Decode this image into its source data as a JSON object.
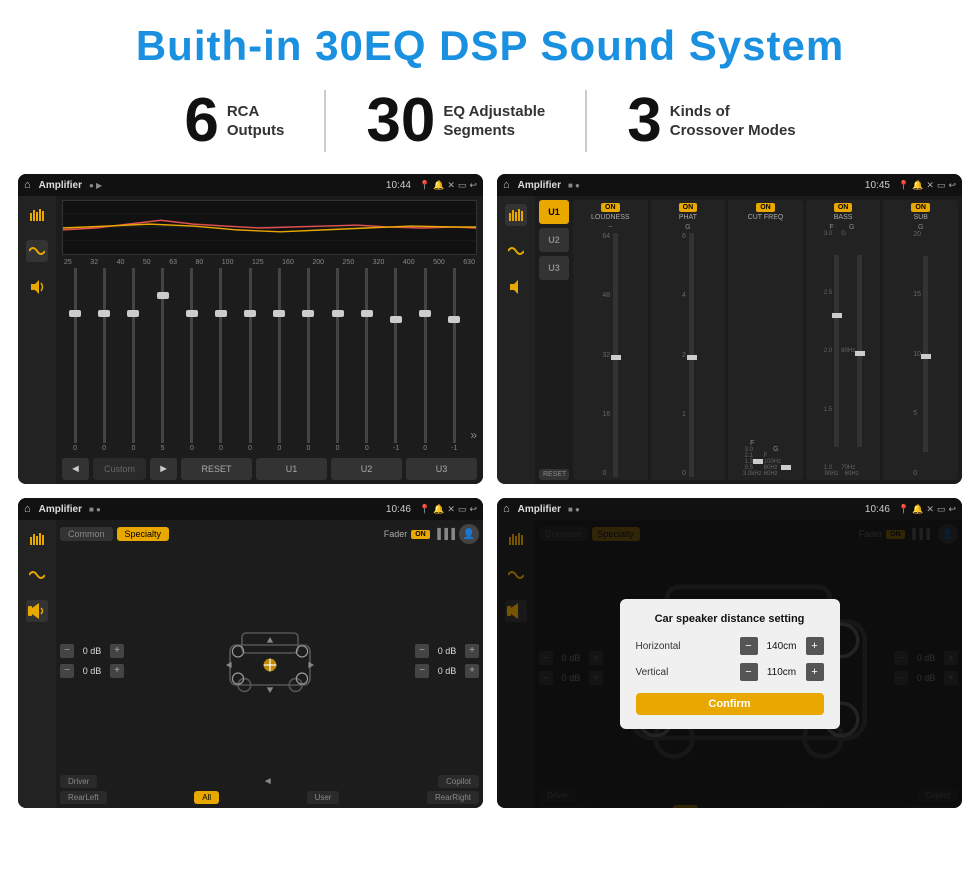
{
  "page": {
    "title": "Buith-in 30EQ DSP Sound System",
    "stats": [
      {
        "number": "6",
        "label": "RCA\nOutputs"
      },
      {
        "number": "30",
        "label": "EQ Adjustable\nSegments"
      },
      {
        "number": "3",
        "label": "Kinds of\nCrossover Modes"
      }
    ],
    "screens": [
      {
        "id": "eq-screen",
        "app_title": "Amplifier",
        "time": "10:44",
        "type": "eq",
        "freq_labels": [
          "25",
          "32",
          "40",
          "50",
          "63",
          "80",
          "100",
          "125",
          "160",
          "200",
          "250",
          "320",
          "400",
          "500",
          "630"
        ],
        "sliders": [
          0,
          0,
          0,
          5,
          0,
          0,
          0,
          0,
          0,
          0,
          0,
          -1,
          0,
          -1
        ],
        "bottom_btns": [
          "◄",
          "Custom",
          "►",
          "RESET",
          "U1",
          "U2",
          "U3"
        ]
      },
      {
        "id": "dsp-screen",
        "app_title": "Amplifier",
        "time": "10:45",
        "type": "dsp",
        "presets": [
          "U1",
          "U2",
          "U3"
        ],
        "channels": [
          {
            "name": "LOUDNESS",
            "on": true
          },
          {
            "name": "PHAT",
            "on": true
          },
          {
            "name": "CUT FREQ",
            "on": true
          },
          {
            "name": "BASS",
            "on": true
          },
          {
            "name": "SUB",
            "on": true
          }
        ],
        "reset_label": "RESET"
      },
      {
        "id": "fader-screen",
        "app_title": "Amplifier",
        "time": "10:46",
        "type": "fader",
        "tabs": [
          "Common",
          "Specialty"
        ],
        "fader_label": "Fader",
        "fader_on": "ON",
        "db_values": [
          "0 dB",
          "0 dB",
          "0 dB",
          "0 dB"
        ],
        "bottom_btns": [
          "Driver",
          "",
          "Copilot",
          "RearLeft",
          "All",
          "User",
          "RearRight"
        ]
      },
      {
        "id": "distance-screen",
        "app_title": "Amplifier",
        "time": "10:46",
        "type": "distance",
        "tabs": [
          "Common",
          "Specialty"
        ],
        "dialog": {
          "title": "Car speaker distance setting",
          "horizontal_label": "Horizontal",
          "horizontal_value": "140cm",
          "vertical_label": "Vertical",
          "vertical_value": "110cm",
          "confirm_label": "Confirm"
        },
        "db_values": [
          "0 dB",
          "0 dB"
        ],
        "bottom_btns": [
          "Driver",
          "Copilot",
          "RearLeft",
          "User",
          "RearRight"
        ]
      }
    ]
  }
}
